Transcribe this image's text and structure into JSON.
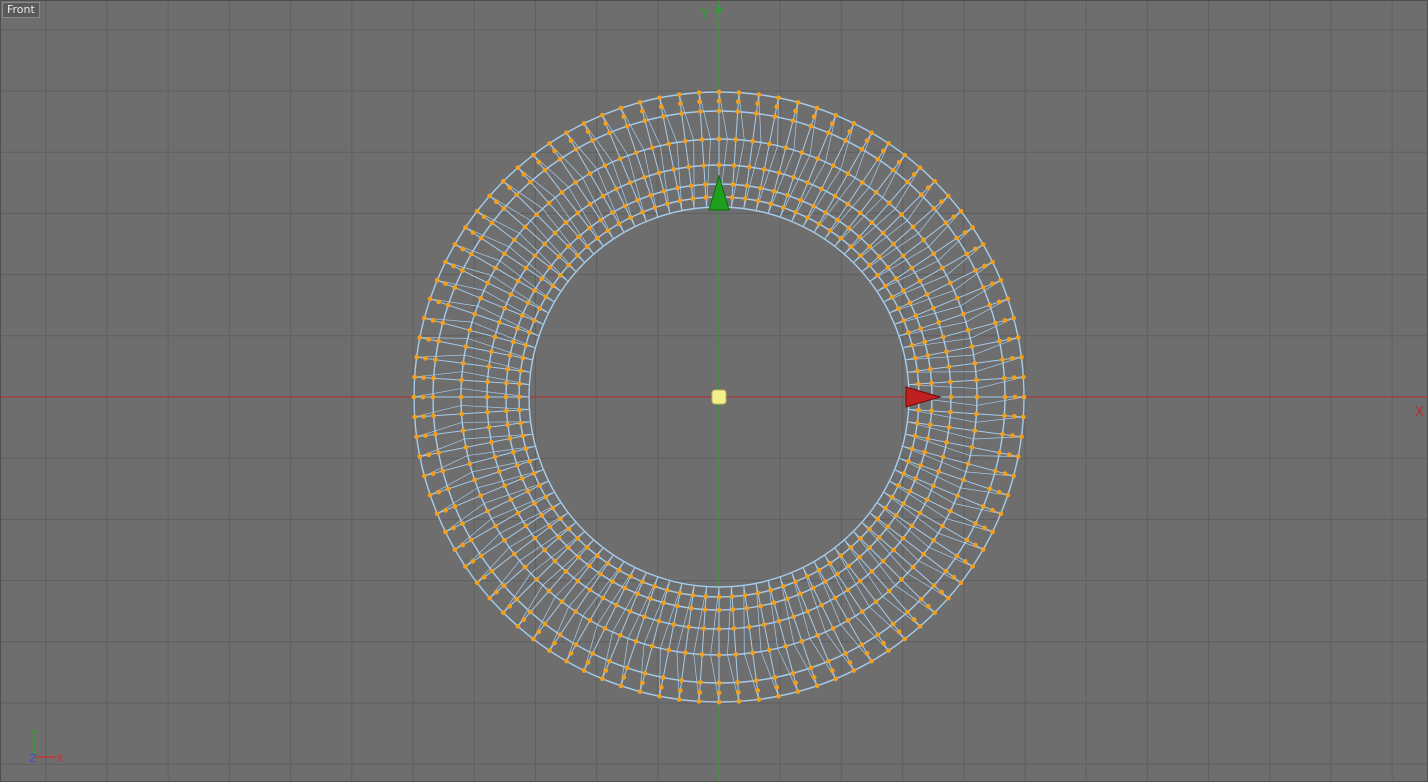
{
  "viewport": {
    "label": "Front",
    "background": "#6e6e6e",
    "grid_color": "#5f5f5f",
    "frame_color": "#4f4f4f"
  },
  "axes": {
    "x_label": "X",
    "y_label": "Y",
    "x_color": "#b03030",
    "y_color": "#2ea02e"
  },
  "gizmo": {
    "x_label": "X",
    "y_label": "Y",
    "z_label": "Z",
    "x_color": "#c83232",
    "y_color": "#2ea02e",
    "z_color": "#3a4fd6"
  },
  "torus": {
    "wire_color": "#a6ccec",
    "point_color": "#f0a020",
    "segments": 96,
    "rings": 7
  },
  "manipulator": {
    "x_handle_color": "#c02020",
    "y_handle_color": "#1ea01e",
    "center_color": "#f4f08a"
  }
}
